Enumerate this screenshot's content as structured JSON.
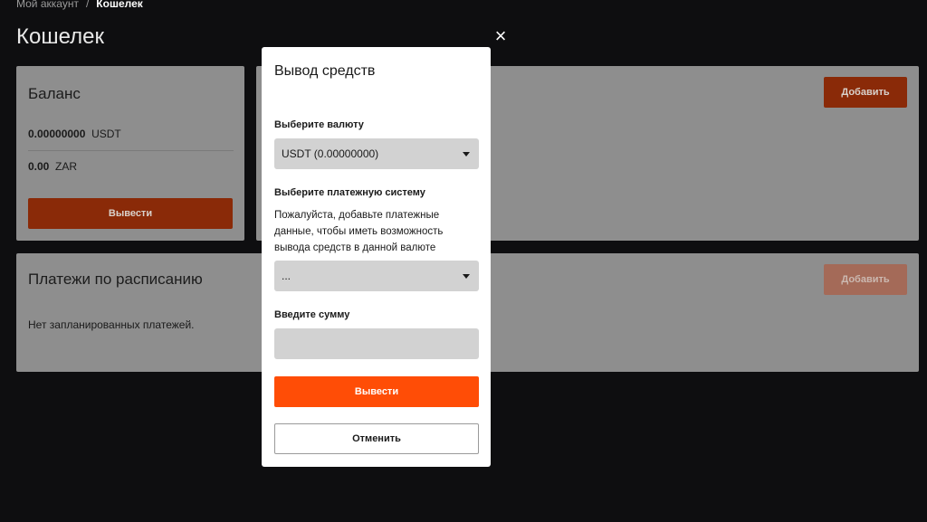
{
  "breadcrumb": {
    "parent": "Мой аккаунт",
    "separator": "/",
    "current": "Кошелек"
  },
  "page_title": "Кошелек",
  "balance_card": {
    "title": "Баланс",
    "rows": [
      {
        "amount": "0.00000000",
        "currency": "USDT"
      },
      {
        "amount": "0.00",
        "currency": "ZAR"
      }
    ],
    "withdraw_label": "Вывести"
  },
  "wallets_card": {
    "add_label": "Добавить"
  },
  "schedule_card": {
    "title": "Платежи по расписанию",
    "add_label": "Добавить",
    "empty_text": "Нет запланированных платежей."
  },
  "modal": {
    "close_icon": "×",
    "title": "Вывод средств",
    "currency_label": "Выберите валюту",
    "currency_value": "USDT (0.00000000)",
    "system_label": "Выберите платежную систему",
    "system_hint": "Пожалуйста, добавьте платежные данные, чтобы иметь возможность вывода средств в данной валюте",
    "system_value": "...",
    "amount_label": "Введите сумму",
    "amount_value": "",
    "submit_label": "Вывести",
    "cancel_label": "Отменить"
  },
  "colors": {
    "background": "#0e0e10",
    "card": "#8e8e8e",
    "accent": "#ff4d06",
    "accent_dimmed": "#8a2a08"
  }
}
